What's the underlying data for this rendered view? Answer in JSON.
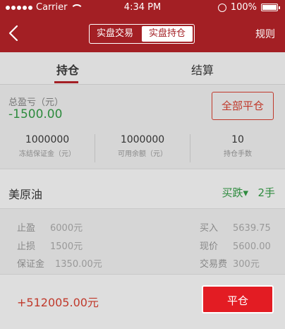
{
  "status_bar": {
    "carrier": "Carrier",
    "time": "4:34 PM",
    "battery": "100%"
  },
  "nav": {
    "segments": [
      "实盘交易",
      "实盘持仓"
    ],
    "active_segment": 1,
    "right_link": "规则"
  },
  "tabs": [
    {
      "label": "持仓"
    },
    {
      "label": "结算"
    }
  ],
  "summary": {
    "pl_label": "总盈亏（元）",
    "pl_value": "-1500.00",
    "close_all": "全部平仓",
    "stats": [
      {
        "value": "1000000",
        "label": "冻结保证金（元）"
      },
      {
        "value": "1000000",
        "label": "可用余额（元）"
      },
      {
        "value": "10",
        "label": "持仓手数"
      }
    ]
  },
  "position": {
    "name": "美原油",
    "direction": "买跌▾",
    "lots": "2手",
    "left": [
      {
        "label": "止盈",
        "value": "6000元"
      },
      {
        "label": "止损",
        "value": "1500元"
      },
      {
        "label": "保证金",
        "value": "1350.00元"
      }
    ],
    "right": [
      {
        "label": "买入",
        "value": "5639.75"
      },
      {
        "label": "现价",
        "value": "5600.00"
      },
      {
        "label": "交易费",
        "value": "300元"
      }
    ],
    "profit": "+512005.00元",
    "close_button": "平仓"
  },
  "colors": {
    "brand_red": "#a31f24",
    "gain_green": "#2e8b3e",
    "loss_red": "#c0392b",
    "button_red": "#e31c23"
  }
}
